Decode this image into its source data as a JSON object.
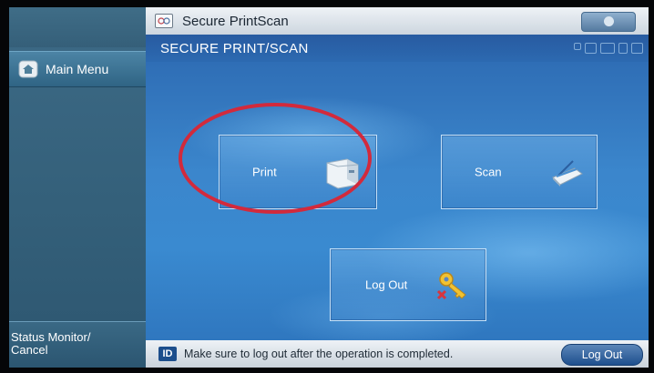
{
  "window": {
    "title": "Secure PrintScan"
  },
  "sidebar": {
    "main_menu_label": "Main Menu",
    "status_monitor_label": "Status Monitor/\nCancel"
  },
  "header": {
    "title": "SECURE PRINT/SCAN"
  },
  "tiles": {
    "print": "Print",
    "scan": "Scan",
    "logout": "Log Out"
  },
  "statusbar": {
    "id_badge": "ID",
    "message": "Make sure to log out after the operation is completed.",
    "logout_button": "Log Out"
  },
  "colors": {
    "annotation_circle": "#d22a3c",
    "accent": "#1c4e8c"
  }
}
